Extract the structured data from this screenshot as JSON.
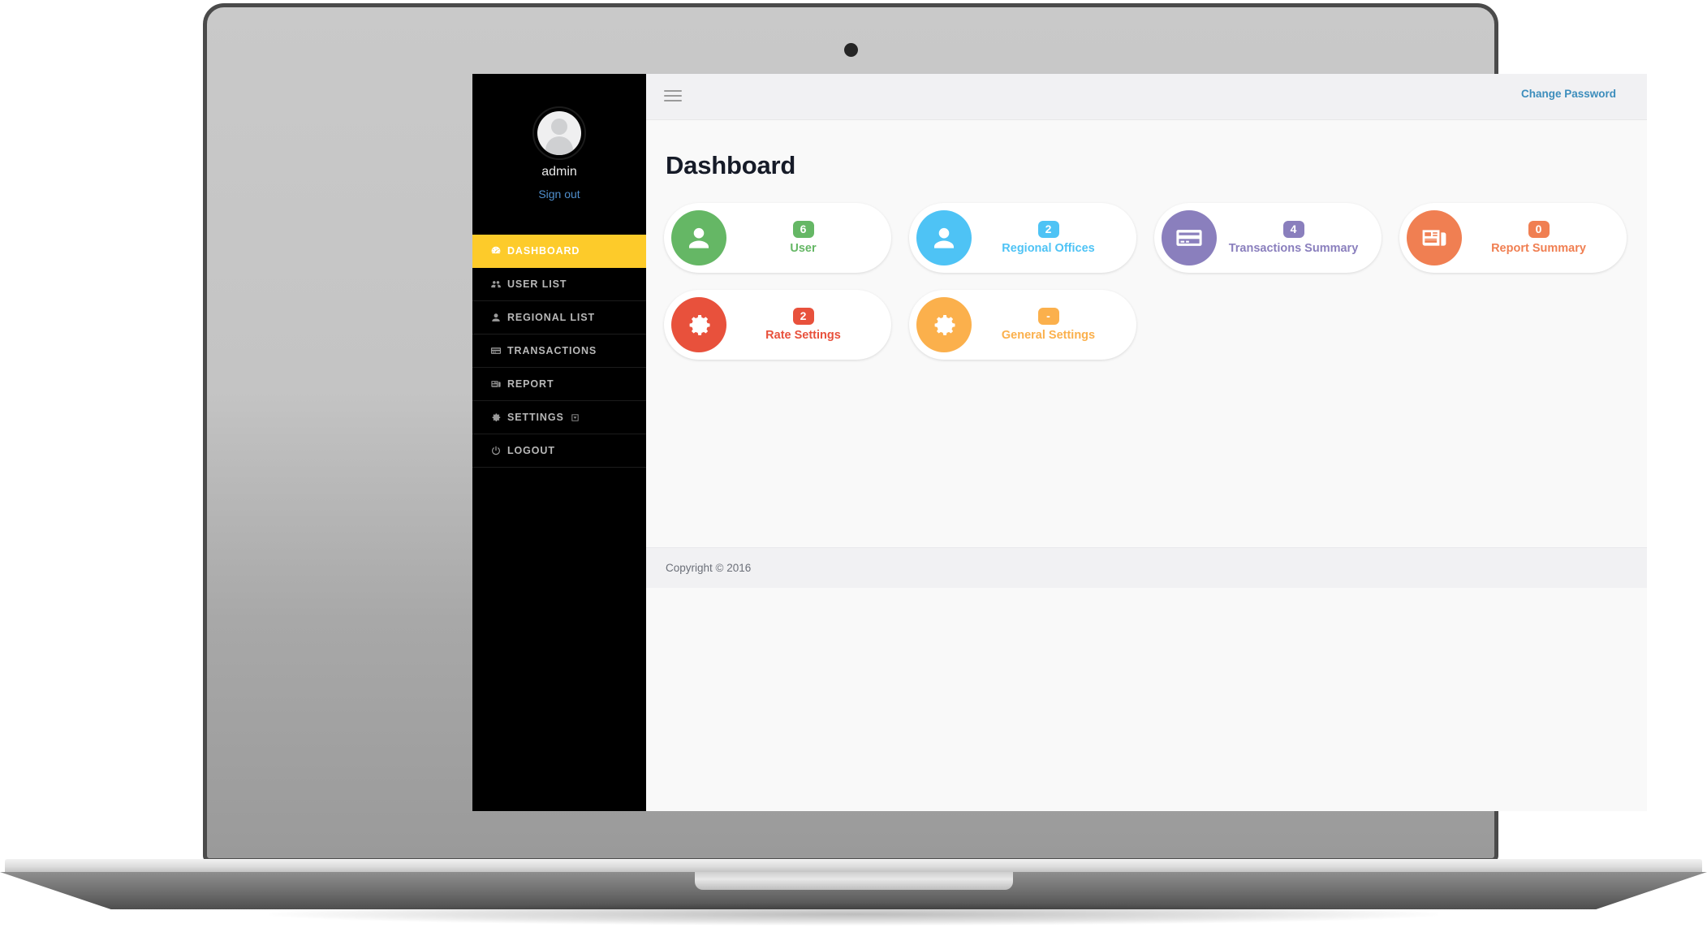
{
  "sidebar": {
    "user": {
      "name": "admin",
      "sign_out_label": "Sign out",
      "avatar_icon": "user-avatar-icon"
    },
    "items": [
      {
        "label": "DASHBOARD",
        "icon": "dashboard-icon",
        "active": true
      },
      {
        "label": "USER LIST",
        "icon": "users-icon",
        "active": false
      },
      {
        "label": "REGIONAL LIST",
        "icon": "user-icon",
        "active": false
      },
      {
        "label": "TRANSACTIONS",
        "icon": "credit-card-icon",
        "active": false
      },
      {
        "label": "REPORT",
        "icon": "newspaper-icon",
        "active": false
      },
      {
        "label": "SETTINGS",
        "icon": "gear-icon",
        "active": false,
        "caret": "caret-down-icon"
      },
      {
        "label": "LOGOUT",
        "icon": "power-icon",
        "active": false
      }
    ],
    "active_color": "#fdcb2a"
  },
  "topbar": {
    "menu_toggle_icon": "hamburger-icon",
    "change_password_label": "Change Password",
    "link_color": "#3c8dbc"
  },
  "main": {
    "page_title": "Dashboard",
    "cards": [
      {
        "badge": "6",
        "label": "User",
        "icon": "user-icon",
        "color": "#65b765"
      },
      {
        "badge": "2",
        "label": "Regional Offices",
        "icon": "user-icon",
        "color": "#4ec3f5"
      },
      {
        "badge": "4",
        "label": "Transactions Summary",
        "icon": "credit-card-icon",
        "color": "#8a7fbd"
      },
      {
        "badge": "0",
        "label": "Report Summary",
        "icon": "newspaper-icon",
        "color": "#f07f52"
      },
      {
        "badge": "2",
        "label": "Rate Settings",
        "icon": "gear-icon",
        "color": "#e8513c"
      },
      {
        "badge": "-",
        "label": "General Settings",
        "icon": "gear-icon",
        "color": "#fbb04c"
      }
    ]
  },
  "footer": {
    "copyright": "Copyright © 2016"
  }
}
